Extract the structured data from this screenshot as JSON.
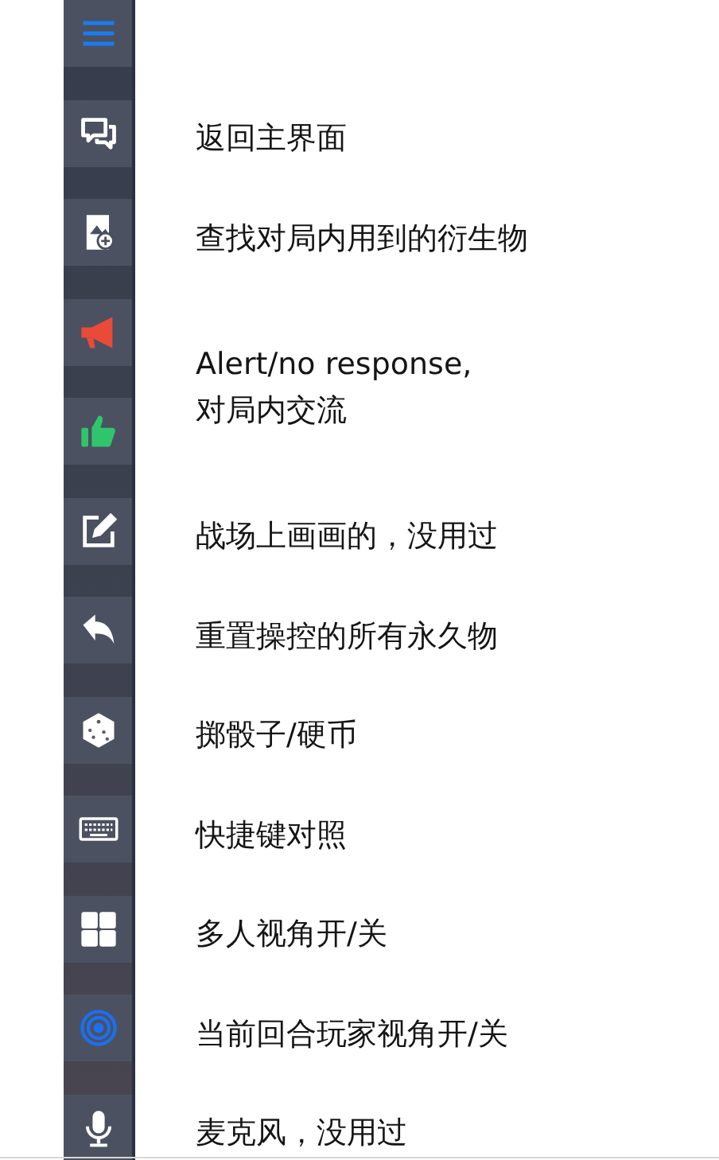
{
  "groups": [
    {
      "buttons": [
        {
          "kind": "menu"
        }
      ]
    },
    {
      "label": "返回主界面",
      "buttons": [
        {
          "kind": "chat"
        }
      ]
    },
    {
      "label": "查找对局内用到的衍生物",
      "buttons": [
        {
          "kind": "image"
        }
      ]
    },
    {
      "label": "Alert/no response,\n对局内交流",
      "buttons": [
        {
          "kind": "megaphone"
        },
        {
          "kind": "thumb"
        }
      ]
    },
    {
      "label": "战场上画画的，没用过",
      "buttons": [
        {
          "kind": "edit"
        }
      ]
    },
    {
      "label": "重置操控的所有永久物",
      "buttons": [
        {
          "kind": "undo"
        }
      ]
    },
    {
      "label": "掷骰子/硬币",
      "buttons": [
        {
          "kind": "dice"
        }
      ]
    },
    {
      "label": "快捷键对照",
      "buttons": [
        {
          "kind": "keyboard"
        }
      ]
    },
    {
      "label": "多人视角开/关",
      "buttons": [
        {
          "kind": "grid"
        }
      ]
    },
    {
      "label": "当前回合玩家视角开/关",
      "buttons": [
        {
          "kind": "target"
        }
      ]
    },
    {
      "label": "麦克风，没用过",
      "buttons": [
        {
          "kind": "mic"
        }
      ]
    }
  ]
}
